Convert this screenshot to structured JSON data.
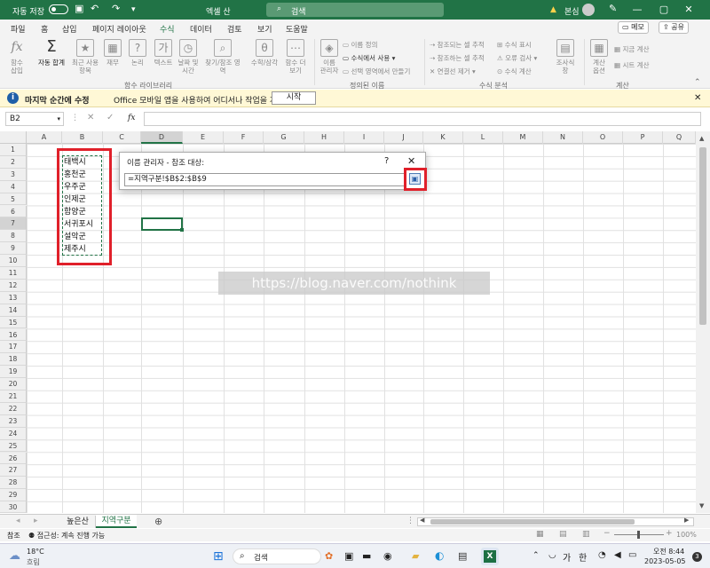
{
  "titlebar": {
    "autosave": "자동 저장",
    "filename": "엑셀 산",
    "search": "검색",
    "user": "본심"
  },
  "menu": [
    "파일",
    "홈",
    "삽입",
    "페이지 레이아웃",
    "수식",
    "데이터",
    "검토",
    "보기",
    "도움말"
  ],
  "menu_buttons": {
    "memo": "메모",
    "share": "공유"
  },
  "ribbon": {
    "buttons": [
      {
        "label": "함수\n삽입",
        "icon": "fx"
      },
      {
        "label": "자동 합계",
        "icon": "Σ"
      },
      {
        "label": "최근 사용\n항목",
        "icon": "★"
      },
      {
        "label": "재무",
        "icon": "▦"
      },
      {
        "label": "논리",
        "icon": "?"
      },
      {
        "label": "텍스트",
        "icon": "가"
      },
      {
        "label": "날짜 및\n시간",
        "icon": "◷"
      },
      {
        "label": "찾기/참조 영역",
        "icon": "⌕"
      },
      {
        "label": "수학/삼각",
        "icon": "θ"
      },
      {
        "label": "함수 더\n보기",
        "icon": "⋯"
      },
      {
        "label": "이름\n관리자",
        "icon": "◈"
      }
    ],
    "name_items": [
      "이름 정의",
      "수식에서 사용",
      "선택 영역에서 만들기"
    ],
    "audit_items": [
      "참조되는 셀 추적",
      "참조하는 셀 추적",
      "연결선 제거",
      "수식 표시",
      "오류 검사",
      "수식 계산"
    ],
    "watch": "조사식\n창",
    "calc_options": "계산\n옵션",
    "calc_items": [
      "지금 계산",
      "시트 계산"
    ],
    "groups": [
      "함수 라이브러리",
      "정의된 이름",
      "수식 분석",
      "계산"
    ]
  },
  "infobar": {
    "bold": "마지막 순간에 수정",
    "text": "Office 모바일 앱을 사용하여 어디서나 작업을 계속하세요.",
    "button": "시작"
  },
  "formula": {
    "namebox": "B2",
    "fx": "fx"
  },
  "columns": [
    "A",
    "B",
    "C",
    "D",
    "E",
    "F",
    "G",
    "H",
    "I",
    "J",
    "K",
    "L",
    "M",
    "N",
    "O",
    "P",
    "Q"
  ],
  "rows": [
    "1",
    "2",
    "3",
    "4",
    "5",
    "6",
    "7",
    "8",
    "9",
    "10",
    "11",
    "12",
    "13",
    "14",
    "15",
    "16",
    "17",
    "18",
    "19",
    "20",
    "21",
    "22",
    "23",
    "24",
    "25",
    "26",
    "27",
    "28",
    "29",
    "30"
  ],
  "cells_b": [
    "태백시",
    "홍천군",
    "우주군",
    "인제군",
    "함양군",
    "서귀포시",
    "설악군",
    "제주시"
  ],
  "dialog": {
    "title": "이름 관리자 - 참조 대상:",
    "help": "?",
    "close": "✕",
    "ref": "=지역구분!$B$2:$B$9"
  },
  "watermark": "https://blog.naver.com/nothink",
  "sheets": [
    "높은산",
    "지역구분"
  ],
  "status": {
    "mode": "참조",
    "accessibility": "접근성: 계속 진행 가능",
    "zoom": "100%"
  },
  "taskbar": {
    "temp": "18°C",
    "weather": "흐림",
    "search": "검색",
    "time": "오전 8:44",
    "date": "2023-05-05",
    "ime1": "가",
    "ime2": "한",
    "badge": "3"
  }
}
